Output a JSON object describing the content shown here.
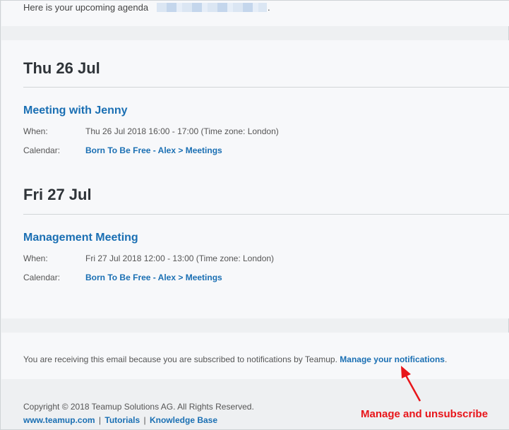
{
  "intro": {
    "text": "Here is your upcoming agenda",
    "trailing": "."
  },
  "days": [
    {
      "heading": "Thu 26 Jul",
      "event": {
        "title": "Meeting with Jenny",
        "when_label": "When:",
        "when_value": "Thu 26 Jul 2018 16:00 - 17:00 (Time zone: London)",
        "calendar_label": "Calendar:",
        "calendar_value": "Born To Be Free - Alex > Meetings"
      }
    },
    {
      "heading": "Fri 27 Jul",
      "event": {
        "title": "Management Meeting",
        "when_label": "When:",
        "when_value": "Fri 27 Jul 2018 12:00 - 13:00 (Time zone: London)",
        "calendar_label": "Calendar:",
        "calendar_value": "Born To Be Free - Alex > Meetings"
      }
    }
  ],
  "notice": {
    "text": "You are receiving this email because you are subscribed to notifications by Teamup.",
    "link": "Manage your notifications",
    "trailing": "."
  },
  "footer": {
    "copyright": "Copyright © 2018 Teamup Solutions AG. All Rights Reserved.",
    "links": [
      "www.teamup.com",
      "Tutorials",
      "Knowledge Base"
    ],
    "separator": "|"
  },
  "annotation": {
    "text": "Manage and unsubscribe",
    "color": "#e8151a"
  },
  "colors": {
    "link": "#1a6fb3",
    "heading": "#2e3338"
  }
}
